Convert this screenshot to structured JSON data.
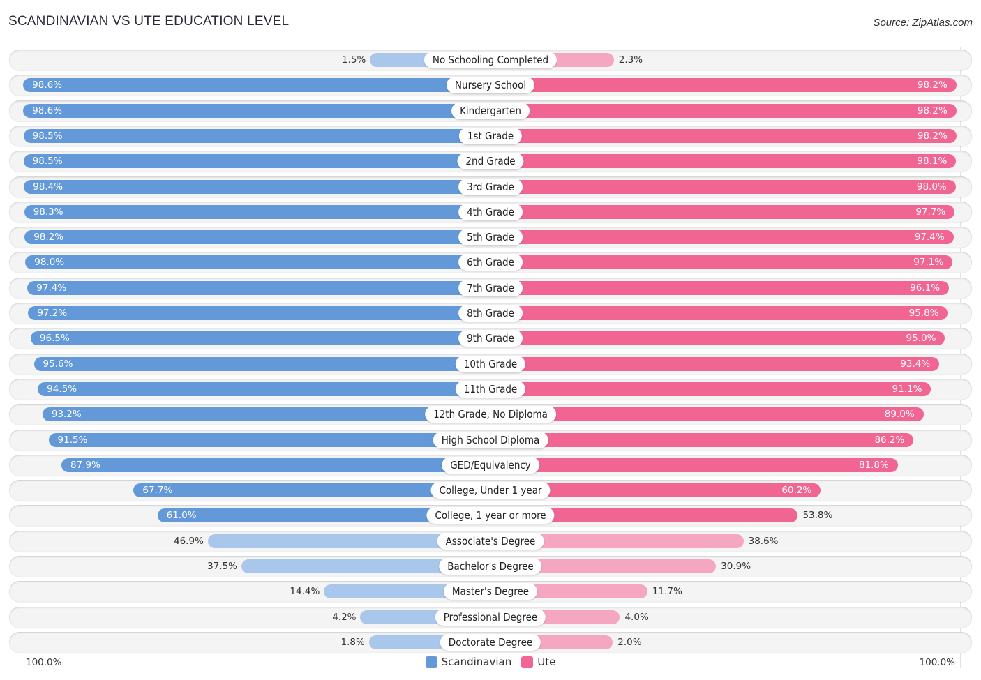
{
  "title": "SCANDINAVIAN VS UTE EDUCATION LEVEL",
  "source": "Source: ZipAtlas.com",
  "colors": {
    "left_strong": "#6399d9",
    "left_light": "#a9c7eb",
    "right_strong": "#f06592",
    "right_light": "#f5a7c1"
  },
  "chart_data": {
    "type": "bar",
    "orientation": "horizontal-diverging",
    "title": "SCANDINAVIAN VS UTE EDUCATION LEVEL",
    "xlabel": "",
    "ylabel": "",
    "axis_left_label": "100.0%",
    "axis_right_label": "100.0%",
    "xlim": [
      0,
      100
    ],
    "legend_position": "bottom-center",
    "categories": [
      "No Schooling Completed",
      "Nursery School",
      "Kindergarten",
      "1st Grade",
      "2nd Grade",
      "3rd Grade",
      "4th Grade",
      "5th Grade",
      "6th Grade",
      "7th Grade",
      "8th Grade",
      "9th Grade",
      "10th Grade",
      "11th Grade",
      "12th Grade, No Diploma",
      "High School Diploma",
      "GED/Equivalency",
      "College, Under 1 year",
      "College, 1 year or more",
      "Associate's Degree",
      "Bachelor's Degree",
      "Master's Degree",
      "Professional Degree",
      "Doctorate Degree"
    ],
    "series": [
      {
        "name": "Scandinavian",
        "side": "left",
        "values": [
          1.5,
          98.6,
          98.6,
          98.5,
          98.5,
          98.4,
          98.3,
          98.2,
          98.0,
          97.4,
          97.2,
          96.5,
          95.6,
          94.5,
          93.2,
          91.5,
          87.9,
          67.7,
          61.0,
          46.9,
          37.5,
          14.4,
          4.2,
          1.8
        ],
        "labels": [
          "1.5%",
          "98.6%",
          "98.6%",
          "98.5%",
          "98.5%",
          "98.4%",
          "98.3%",
          "98.2%",
          "98.0%",
          "97.4%",
          "97.2%",
          "96.5%",
          "95.6%",
          "94.5%",
          "93.2%",
          "91.5%",
          "87.9%",
          "67.7%",
          "61.0%",
          "46.9%",
          "37.5%",
          "14.4%",
          "4.2%",
          "1.8%"
        ]
      },
      {
        "name": "Ute",
        "side": "right",
        "values": [
          2.3,
          98.2,
          98.2,
          98.2,
          98.1,
          98.0,
          97.7,
          97.4,
          97.1,
          96.1,
          95.8,
          95.0,
          93.4,
          91.1,
          89.0,
          86.2,
          81.8,
          60.2,
          53.8,
          38.6,
          30.9,
          11.7,
          4.0,
          2.0
        ],
        "labels": [
          "2.3%",
          "98.2%",
          "98.2%",
          "98.2%",
          "98.1%",
          "98.0%",
          "97.7%",
          "97.4%",
          "97.1%",
          "96.1%",
          "95.8%",
          "95.0%",
          "93.4%",
          "91.1%",
          "89.0%",
          "86.2%",
          "81.8%",
          "60.2%",
          "53.8%",
          "38.6%",
          "30.9%",
          "11.7%",
          "4.0%",
          "2.0%"
        ]
      }
    ]
  },
  "legend": [
    {
      "label": "Scandinavian",
      "color": "#6399d9"
    },
    {
      "label": "Ute",
      "color": "#f06592"
    }
  ]
}
